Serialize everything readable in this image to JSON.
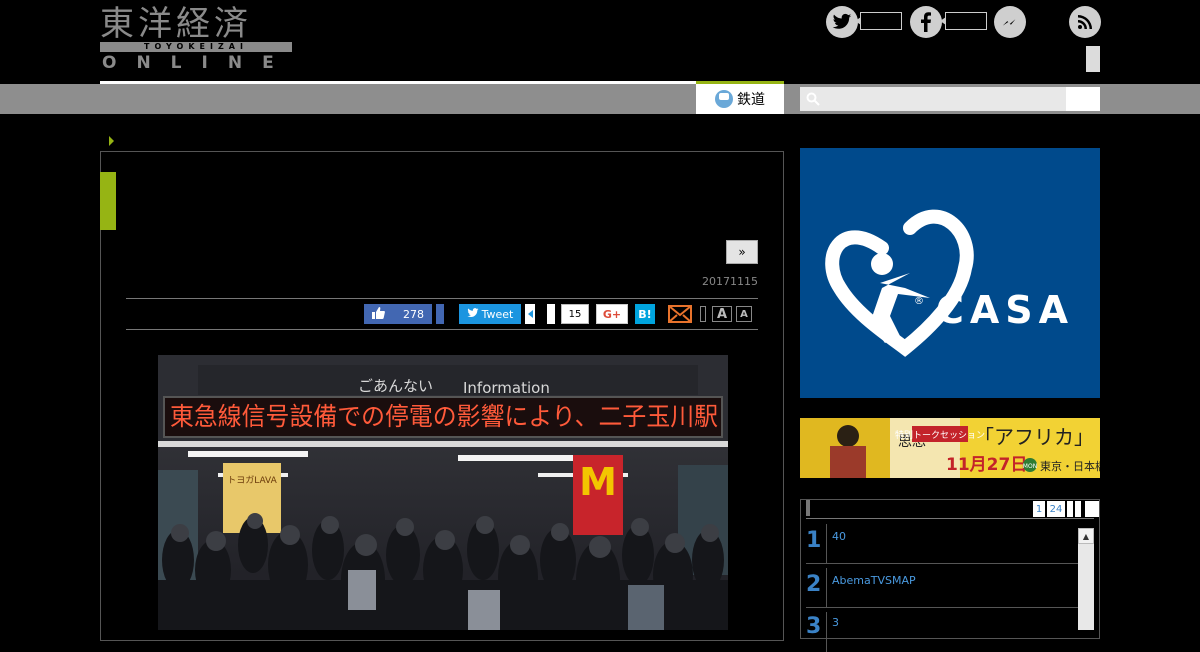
{
  "logo": {
    "kanji": "東洋経済",
    "sub": "TOYOKEIZAI",
    "online": "ONLINE"
  },
  "social_top": {
    "twitter": "t",
    "facebook": "f"
  },
  "nav": {
    "tab_label": "鉄道"
  },
  "article": {
    "next_label": "»",
    "date": "20171115",
    "share": {
      "like_count": "278",
      "tweet_label": "Tweet",
      "pocket_count": "15",
      "gplus_label": "G+",
      "hatena_label": "B!",
      "font_large": "A",
      "font_small": "A"
    },
    "photo": {
      "sign_title": "ごあんない",
      "sign_info": "Information",
      "ticker": "東急線信号設備での停電の影響により、二子玉川駅",
      "shop_sign": "トヨガLAVA"
    }
  },
  "ads": {
    "casa": "CASA",
    "africa_title": "「アフリカ」",
    "africa_label": "特別トークセッション",
    "africa_date": "11月27日",
    "africa_day": "MON",
    "africa_place": "東京・日本橋",
    "africa_mid": "思想"
  },
  "ranking": {
    "tabs": [
      "1",
      "24"
    ],
    "items": [
      {
        "rank": "1",
        "title": "40"
      },
      {
        "rank": "2",
        "title": "AbemaTVSMAP"
      },
      {
        "rank": "3",
        "title": "3"
      }
    ]
  }
}
